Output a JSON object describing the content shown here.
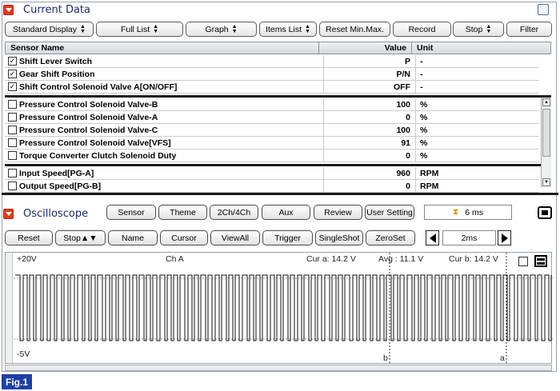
{
  "current_data": {
    "title": "Current Data",
    "toolbar": [
      {
        "label": "Standard Display",
        "select": true
      },
      {
        "label": "Full List",
        "select": true
      },
      {
        "label": "Graph",
        "select": true
      },
      {
        "label": "Items List",
        "select": true
      },
      {
        "label": "Reset Min.Max.",
        "select": false
      },
      {
        "label": "Record",
        "select": false
      },
      {
        "label": "Stop",
        "select": true
      },
      {
        "label": "Filter",
        "select": false
      }
    ],
    "table": {
      "headers": {
        "name": "Sensor Name",
        "value": "Value",
        "unit": "Unit"
      },
      "pinned_rows": [
        {
          "checked": true,
          "name": "Shift Lever Switch",
          "value": "P",
          "unit": "-"
        },
        {
          "checked": true,
          "name": "Gear Shift Position",
          "value": "P/N",
          "unit": "-"
        },
        {
          "checked": true,
          "name": "Shift Control Solenoid Valve A[ON/OFF]",
          "value": "OFF",
          "unit": "-"
        }
      ],
      "rows": [
        {
          "checked": false,
          "name": "Pressure Control Solenoid Valve-B",
          "value": "100",
          "unit": "%"
        },
        {
          "checked": false,
          "name": "Pressure Control Solenoid Valve-A",
          "value": "0",
          "unit": "%"
        },
        {
          "checked": false,
          "name": "Pressure Control Solenoid Valve-C",
          "value": "100",
          "unit": "%"
        },
        {
          "checked": false,
          "name": "Pressure Control Solenoid Valve[VFS]",
          "value": "91",
          "unit": "%"
        },
        {
          "checked": false,
          "name": "Torque Converter Clutch Solenoid Duty",
          "value": "0",
          "unit": "%"
        }
      ],
      "lower_rows": [
        {
          "checked": false,
          "name": "Input Speed[PG-A]",
          "value": "960",
          "unit": "RPM"
        },
        {
          "checked": false,
          "name": "Output Speed[PG-B]",
          "value": "0",
          "unit": "RPM"
        }
      ]
    }
  },
  "oscilloscope": {
    "title": "Oscilloscope",
    "row1": [
      "Sensor",
      "Theme",
      "2Ch/4Ch",
      "Aux",
      "Review",
      "User Setting"
    ],
    "time_display": "6 ms",
    "row2": [
      {
        "label": "Reset",
        "select": false
      },
      {
        "label": "Stop",
        "select": true
      },
      {
        "label": "Name",
        "select": false
      },
      {
        "label": "Cursor",
        "select": false
      },
      {
        "label": "ViewAll",
        "select": false
      },
      {
        "label": "Trigger",
        "select": false
      },
      {
        "label": "SingleShot",
        "select": false
      },
      {
        "label": "ZeroSet",
        "select": false
      }
    ],
    "timebase": "2ms",
    "scope": {
      "v_max": "+20V",
      "v_min": "-5V",
      "channel": "Ch A",
      "cur_a": "Cur a: 14.2 V",
      "avg": "Avg : 11.1 V",
      "cur_b": "Cur b: 14.2 V",
      "marker_b": "b",
      "marker_a": "a"
    }
  },
  "figure_label": "Fig.1",
  "colors": {
    "accent": "#e03a1f",
    "title": "#1b2a6b",
    "fig_bg": "#1f3fa6"
  }
}
